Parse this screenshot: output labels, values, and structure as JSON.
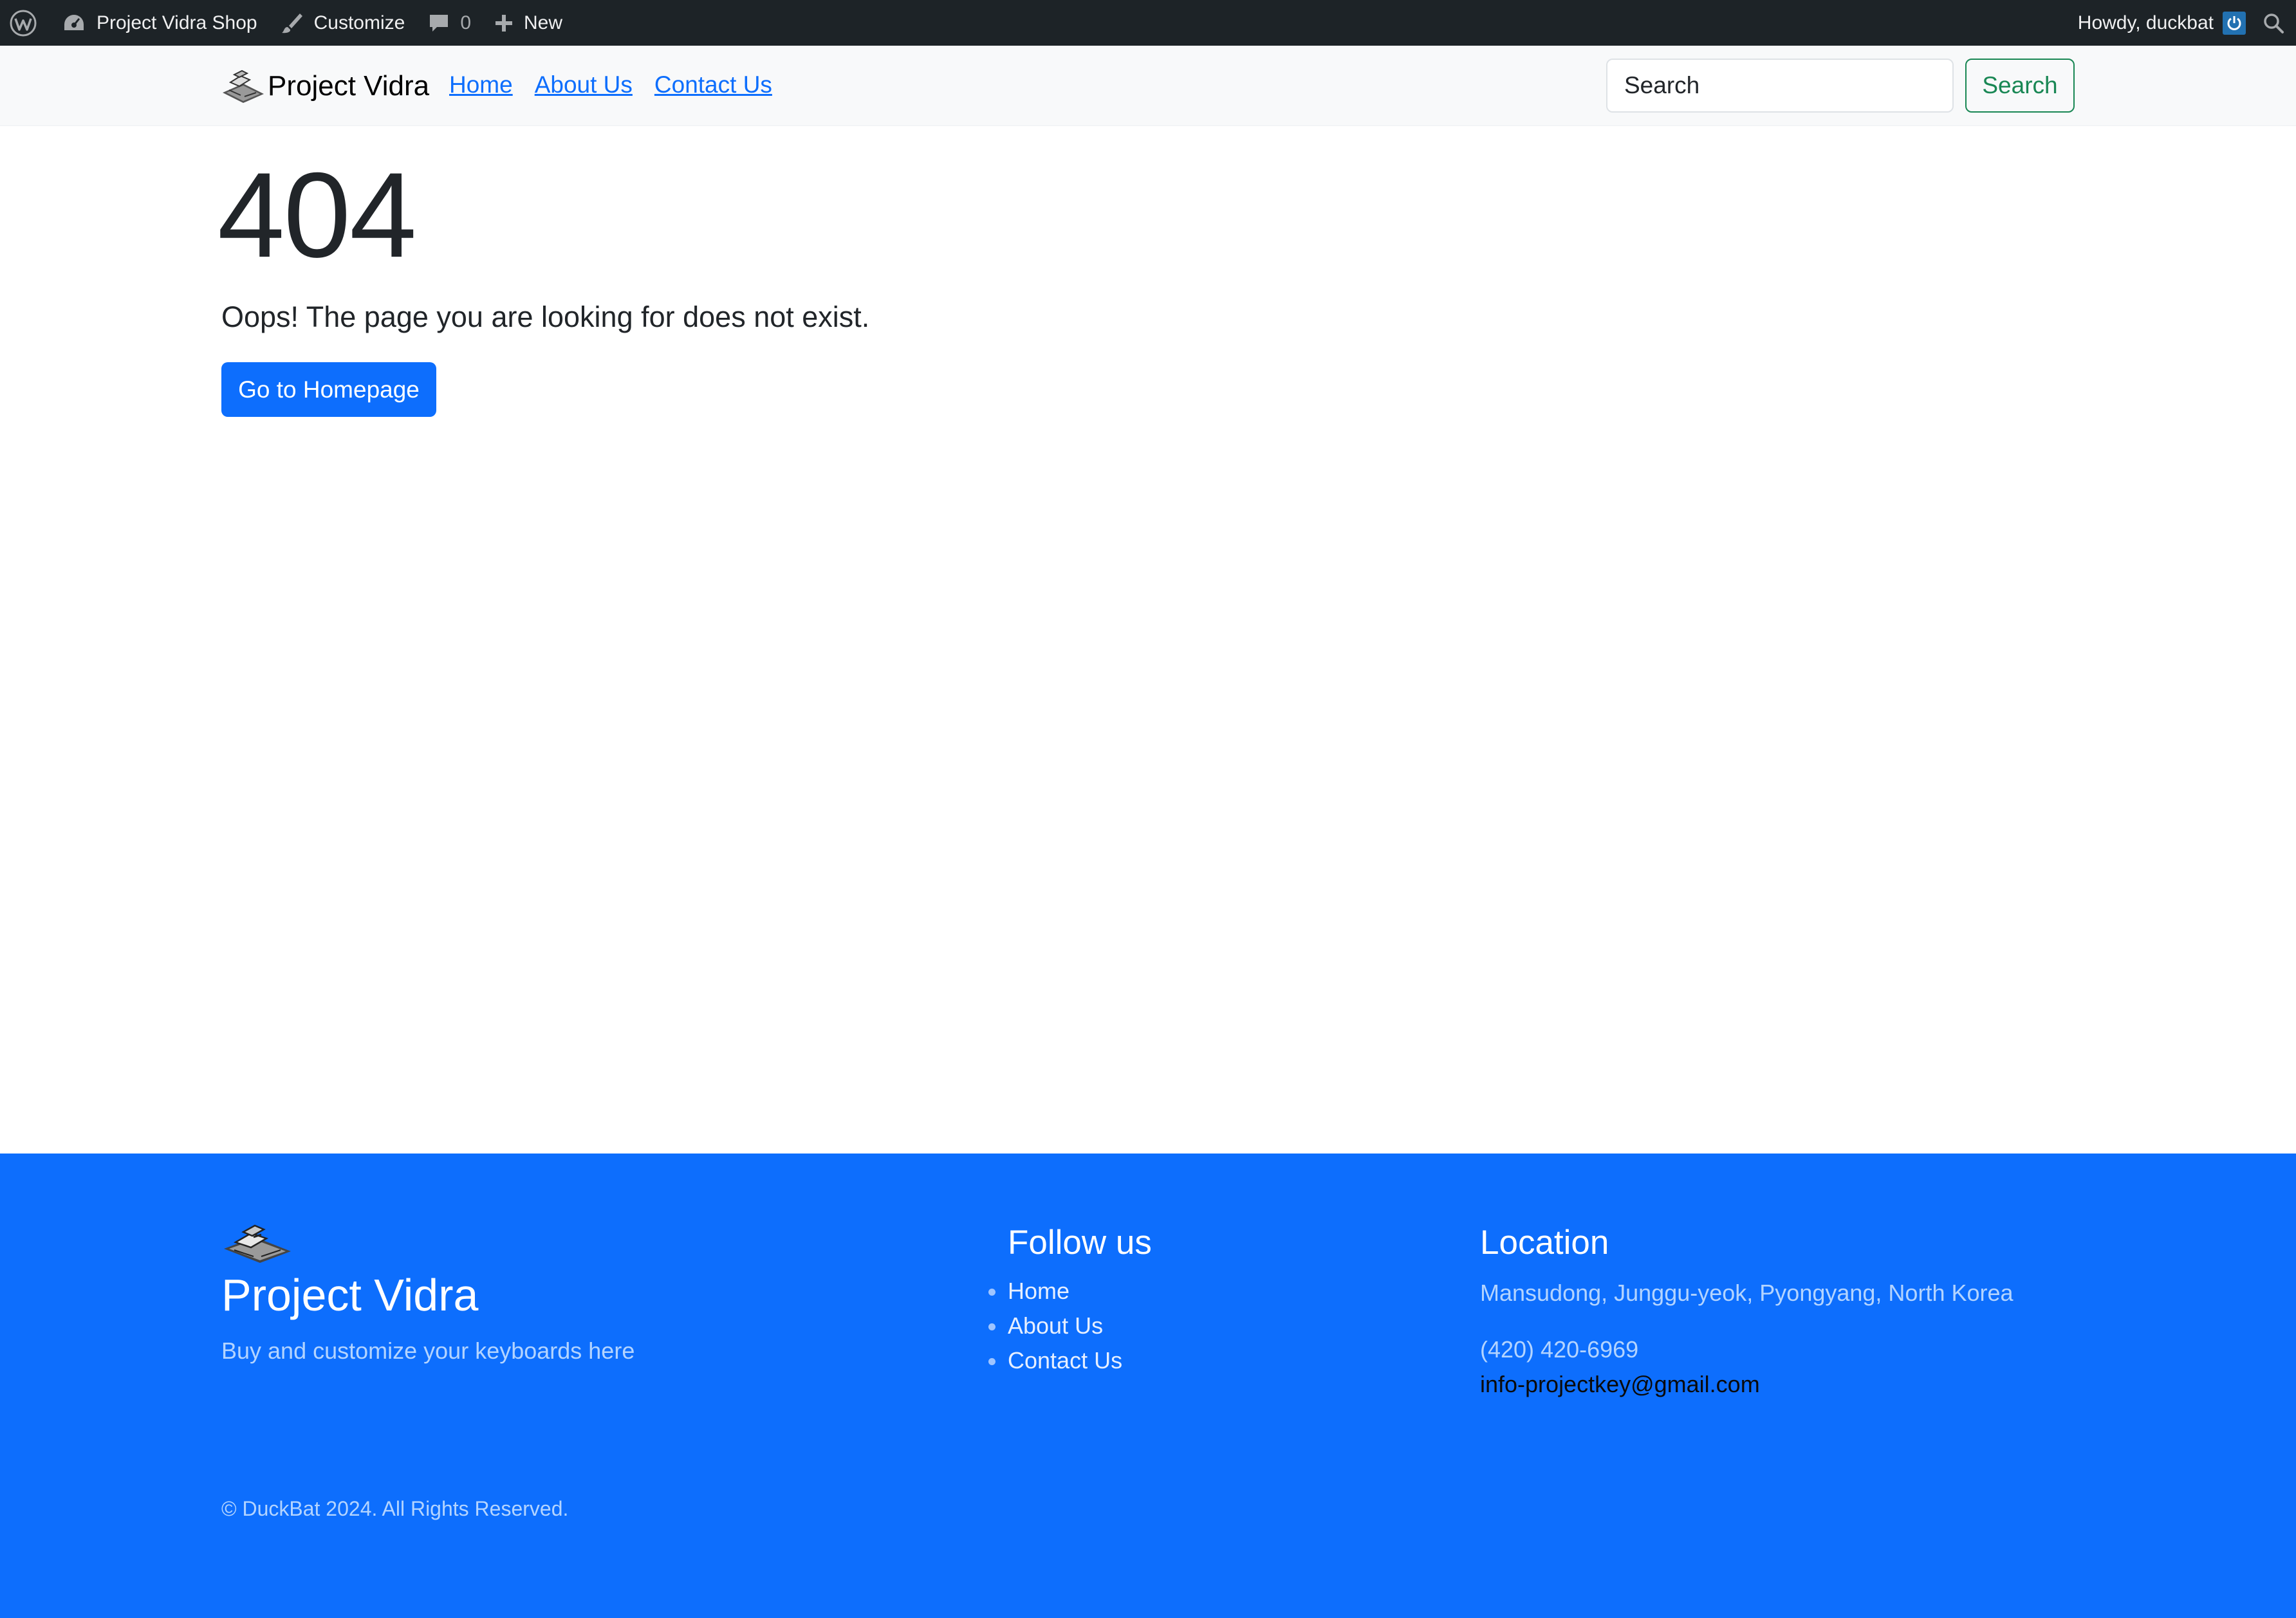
{
  "admin_bar": {
    "site_name": "Project Vidra Shop",
    "customize": "Customize",
    "comments_count": "0",
    "new_label": "New",
    "greeting": "Howdy, duckbat"
  },
  "navbar": {
    "brand": "Project Vidra",
    "links": [
      "Home",
      "About Us",
      "Contact Us"
    ],
    "search_placeholder": "Search",
    "search_button": "Search"
  },
  "main": {
    "code": "404",
    "message": "Oops! The page you are looking for does not exist.",
    "button": "Go to Homepage"
  },
  "footer": {
    "brand": "Project Vidra",
    "tagline": "Buy and customize your keyboards here",
    "follow_heading": "Follow us",
    "follow_links": [
      "Home",
      "About Us",
      "Contact Us"
    ],
    "location_heading": "Location",
    "address": "Mansudong, Junggu-yeok, Pyongyang, North Korea",
    "phone": "(420) 420-6969",
    "email": "info-projectkey@gmail.com",
    "copyright": "© DuckBat 2024. All Rights Reserved."
  },
  "colors": {
    "admin_bar_bg": "#1d2327",
    "primary": "#0d6efd",
    "success": "#198754",
    "navbar_bg": "#f8f9fa"
  }
}
